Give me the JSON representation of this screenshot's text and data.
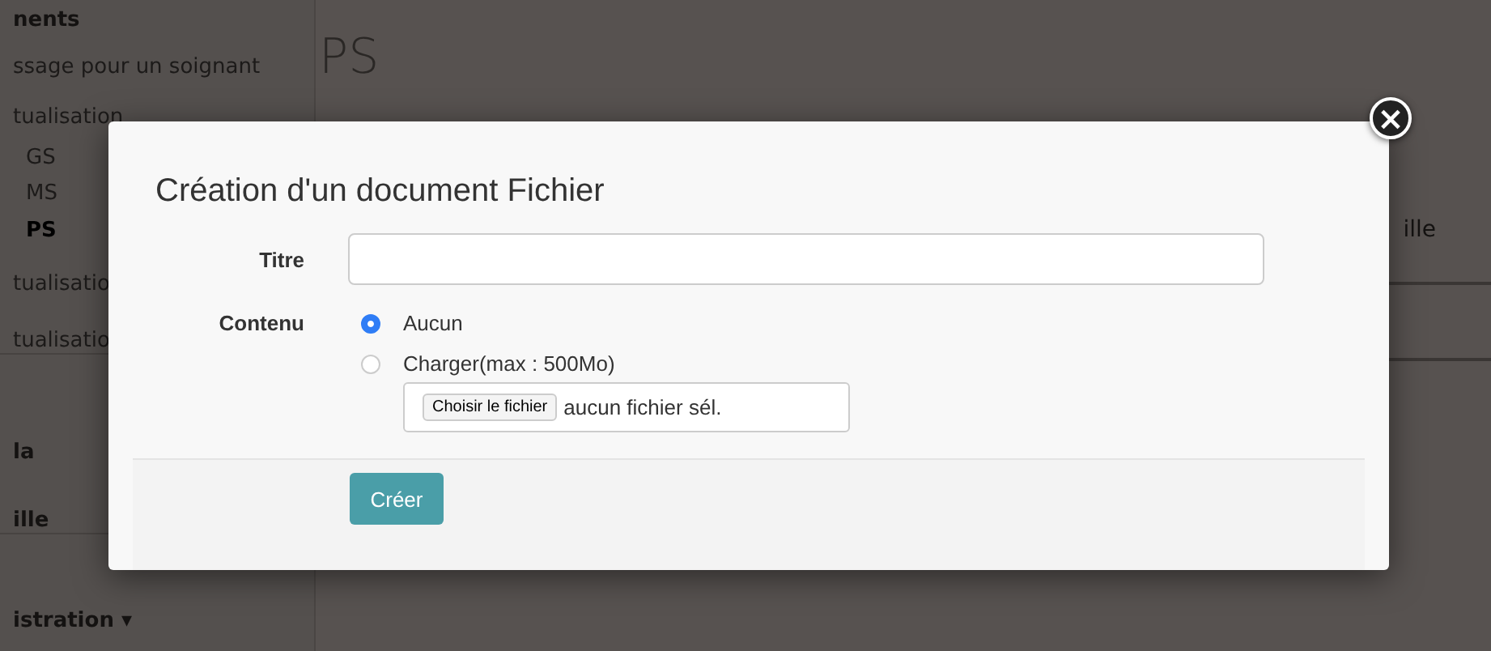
{
  "sidebar": {
    "items": [
      {
        "label": "nents",
        "kind": "section"
      },
      {
        "label": "ssage pour un soignant",
        "kind": "link"
      },
      {
        "label": "tualisation",
        "kind": "link"
      },
      {
        "label": "GS",
        "kind": "subitem",
        "selected": false
      },
      {
        "label": "MS",
        "kind": "subitem",
        "selected": false
      },
      {
        "label": "PS",
        "kind": "subitem",
        "selected": true
      },
      {
        "label": "tualisatio",
        "kind": "link"
      },
      {
        "label": "tualisatio",
        "kind": "link"
      },
      {
        "label": "la",
        "kind": "section"
      },
      {
        "label": "ille",
        "kind": "section"
      },
      {
        "label": "istration ▾",
        "kind": "section"
      }
    ]
  },
  "main": {
    "heading": "PS",
    "side_text": "ille"
  },
  "modal": {
    "title": "Création d'un document Fichier",
    "close": "×",
    "fields": [
      {
        "label": "Titre",
        "kind": "text"
      },
      {
        "label": "Contenu",
        "kind": "radio",
        "options": [
          {
            "label": "Aucun",
            "selected": true
          },
          {
            "label": "Charger(max : 500Mo)",
            "selected": false
          }
        ],
        "file": {
          "button": "Choisir le fichier",
          "status": "aucun fichier sél."
        }
      }
    ],
    "submit": "Créer"
  }
}
